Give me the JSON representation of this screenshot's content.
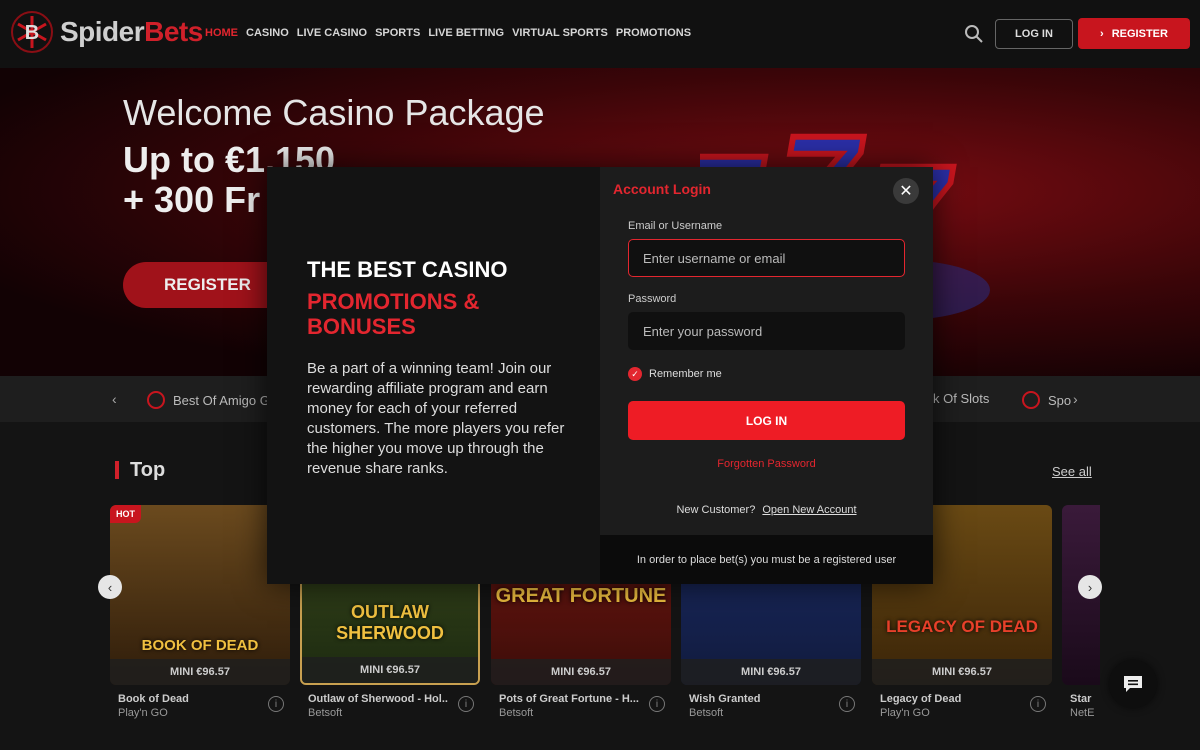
{
  "brand": {
    "spider": "Spider",
    "bets": "Bets",
    "accent": "#d0202a"
  },
  "nav": {
    "items": [
      {
        "label": "HOME",
        "active": true
      },
      {
        "label": "CASINO"
      },
      {
        "label": "LIVE CASINO"
      },
      {
        "label": "SPORTS"
      },
      {
        "label": "LIVE BETTING"
      },
      {
        "label": "VIRTUAL SPORTS"
      },
      {
        "label": "PROMOTIONS"
      }
    ],
    "login_label": "LOG IN",
    "register_label": "REGISTER"
  },
  "hero": {
    "title": "Welcome Casino Package",
    "amount_line1": "Up to €1,150",
    "amount_line2": "+ 300 Fr",
    "register_label": "REGISTER"
  },
  "strip": {
    "items": [
      "Best Of Amigo G",
      "k Of Slots",
      "Spo"
    ]
  },
  "top": {
    "title": "Top",
    "see_all": "See all",
    "hot_badge": "HOT",
    "games": [
      {
        "name": "Book of Dead",
        "provider": "Play'n GO",
        "mini": "MINI €96.57",
        "thumb_text": "BOOK OF DEAD"
      },
      {
        "name": "Outlaw of Sherwood - Hol...",
        "provider": "Betsoft",
        "mini": "MINI €96.57",
        "thumb_text": "OUTLAW SHERWOOD"
      },
      {
        "name": "Pots of Great Fortune - H...",
        "provider": "Betsoft",
        "mini": "MINI €96.57",
        "thumb_text": "GREAT FORTUNE"
      },
      {
        "name": "Wish Granted",
        "provider": "Betsoft",
        "mini": "MINI €96.57",
        "thumb_text": ""
      },
      {
        "name": "Legacy of Dead",
        "provider": "Play'n GO",
        "mini": "MINI €96.57",
        "thumb_text": "LEGACY OF DEAD"
      },
      {
        "name": "Star",
        "provider": "NetE",
        "mini": "",
        "thumb_text": ""
      }
    ]
  },
  "modal": {
    "promo_title": "THE BEST CASINO",
    "promo_red": "PROMOTIONS & BONUSES",
    "promo_text": "Be a part of a winning team! Join our rewarding affiliate program and earn money for each of your referred customers. The more players you refer the higher you move up through the revenue share ranks.",
    "login_title": "Account Login",
    "email_label": "Email or Username",
    "email_placeholder": "Enter username or email",
    "password_label": "Password",
    "password_placeholder": "Enter your password",
    "remember_label": "Remember me",
    "login_button": "LOG IN",
    "forgot": "Forgotten Password",
    "new_customer": "New Customer?",
    "open_account": "Open New Account",
    "footer": "In order to place bet(s) you must be a registered user",
    "close": "✕"
  }
}
